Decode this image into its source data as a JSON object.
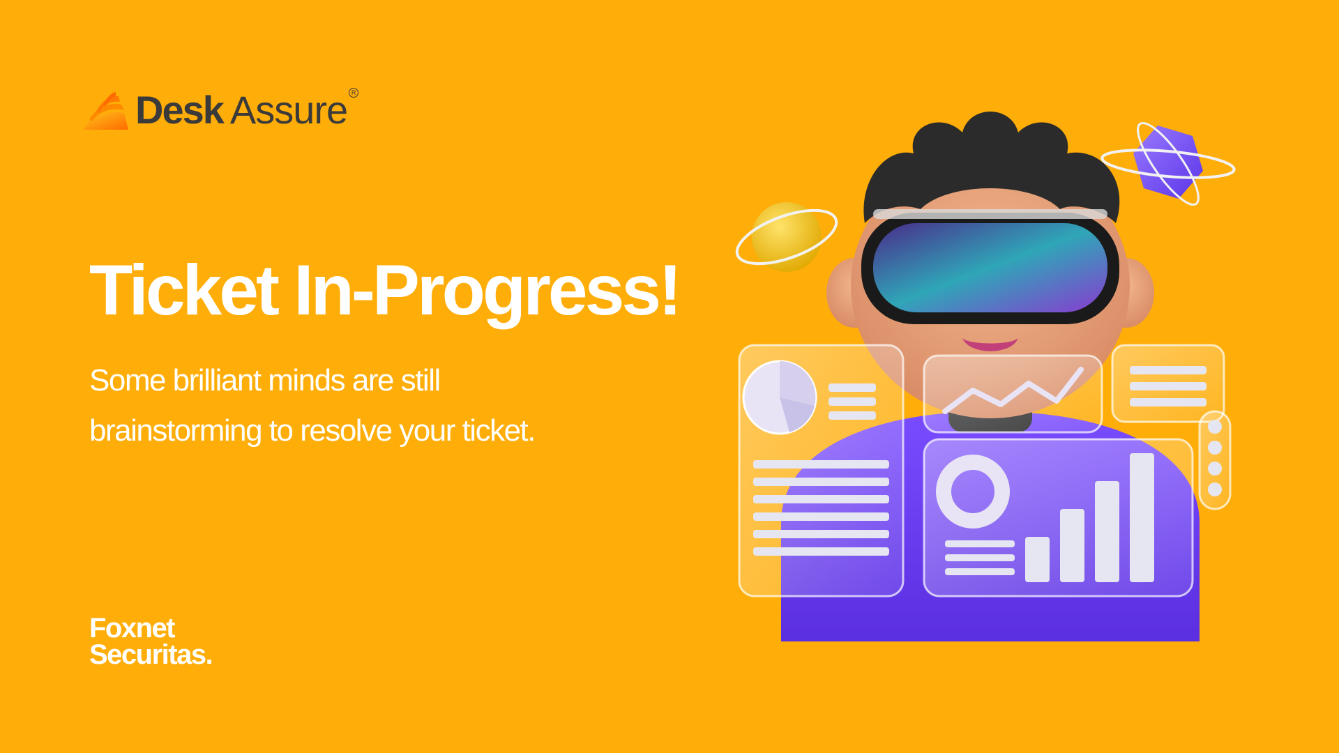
{
  "logo": {
    "word1": "Desk",
    "word2": "Assure",
    "registered": "R",
    "colors": {
      "mark_start": "#FF7A00",
      "mark_end": "#FFC21A",
      "text": "#3A3A3A"
    }
  },
  "headline": {
    "title": "Ticket In-Progress!",
    "subtitle": "Some brilliant minds are still brainstorming to resolve your ticket."
  },
  "brand": {
    "line1": "Foxnet",
    "line2": "Securitas."
  },
  "colors": {
    "background": "#FFAD08",
    "text": "#FFFFFF",
    "accent_purple": "#6B3FF2"
  },
  "illustration": {
    "icons": [
      "vr-headset-icon",
      "planet-icon",
      "crystal-icon",
      "pie-chart-icon",
      "line-chart-icon",
      "bar-chart-icon",
      "donut-chart-icon"
    ]
  }
}
